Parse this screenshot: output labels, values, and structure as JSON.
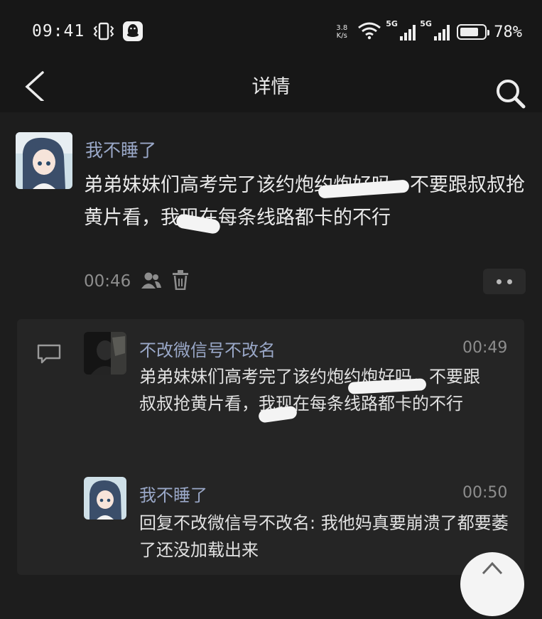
{
  "status_bar": {
    "time": "09:41",
    "net_speed_value": "3.8",
    "net_speed_unit": "K/s",
    "signal_1_label": "5G",
    "signal_2_label": "5G",
    "battery_percent": "78%",
    "battery_level": 0.78,
    "icons": [
      "vibrate-icon",
      "qq-icon",
      "wifi-icon",
      "signal-icon",
      "signal-icon",
      "battery-icon"
    ]
  },
  "header": {
    "title": "详情",
    "left_icon": "back-icon",
    "right_icon": "search-icon"
  },
  "post": {
    "author": "我不睡了",
    "text": "弟弟妹妹们高考完了该约炮约炮好吗，不要跟叔叔抢黄片看，我现在每条线路都卡的不行",
    "time": "00:46",
    "meta_icons": [
      "visibility-friends-icon",
      "delete-icon"
    ],
    "more_icon": "more-dots-icon"
  },
  "comments": [
    {
      "author": "不改微信号不改名",
      "time": "00:49",
      "text": "弟弟妹妹们高考完了该约炮约炮好吗，不要跟叔叔抢黄片看，我现在每条线路都卡的不行"
    },
    {
      "author": "我不睡了",
      "time": "00:50",
      "text": "回复不改微信号不改名: 我他妈真要崩溃了都要萎了还没加载出来"
    }
  ],
  "colors": {
    "background": "#1d1d1d",
    "bar_background": "#171717",
    "comment_panel": "#252525",
    "name_color": "#9aa8c8",
    "meta_color": "#8d8d8d",
    "text_color": "#eaeaea"
  }
}
